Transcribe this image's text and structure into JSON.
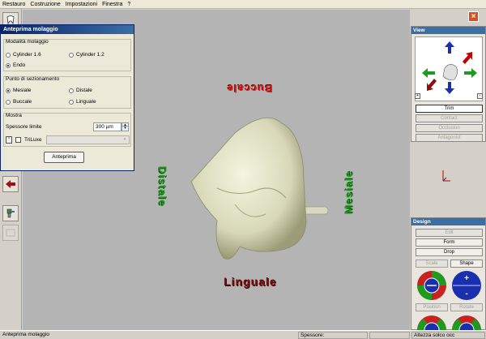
{
  "menu": [
    "Restauro",
    "Costruzione",
    "Impostazioni",
    "Finestra",
    "?"
  ],
  "dialog": {
    "title": "Anteprima molaggio",
    "group_mode": {
      "label": "Modalità molaggio",
      "options": [
        "Cylinder 1.6",
        "Cylinder 1.2",
        "Endo"
      ],
      "selected": "Endo"
    },
    "group_section": {
      "label": "Punto di sezionamento",
      "options": [
        "Mesiale",
        "Distale",
        "Buccale",
        "Linguale"
      ],
      "selected": "Mesiale"
    },
    "group_show": {
      "label": "Mostra",
      "thickness_label": "Spessore limite",
      "thickness_value": "300 µm",
      "triluxe_label": "TriLuxe"
    },
    "preview_button": "Anteprima"
  },
  "viewport": {
    "labels": {
      "top": "Buccale",
      "left": "Distale",
      "right": "Mesiale",
      "bottom": "Linguale"
    },
    "colors": {
      "buccal": "#e02020",
      "distal": "#1e9a1e",
      "mesial": "#1e9a1e",
      "lingual": "#7a1010",
      "tooth": "#e8e8d0"
    }
  },
  "view_panel": {
    "title": "View",
    "buttons": [
      "Trim",
      "Contact",
      "Occlusion",
      "Antagonist"
    ],
    "active": "Trim"
  },
  "design_panel": {
    "title": "Design",
    "buttons": [
      "Edit",
      "Form",
      "Drop"
    ],
    "disabled": [
      "Edit"
    ],
    "tool_labels": [
      "Scale",
      "Shape",
      "Position",
      "Rotate"
    ],
    "shape_plus": "+",
    "shape_minus": "-"
  },
  "status": {
    "message": "Anteprima molaggio",
    "thickness_label": "Spessore:",
    "groove_label": "Altezza solco occ"
  }
}
